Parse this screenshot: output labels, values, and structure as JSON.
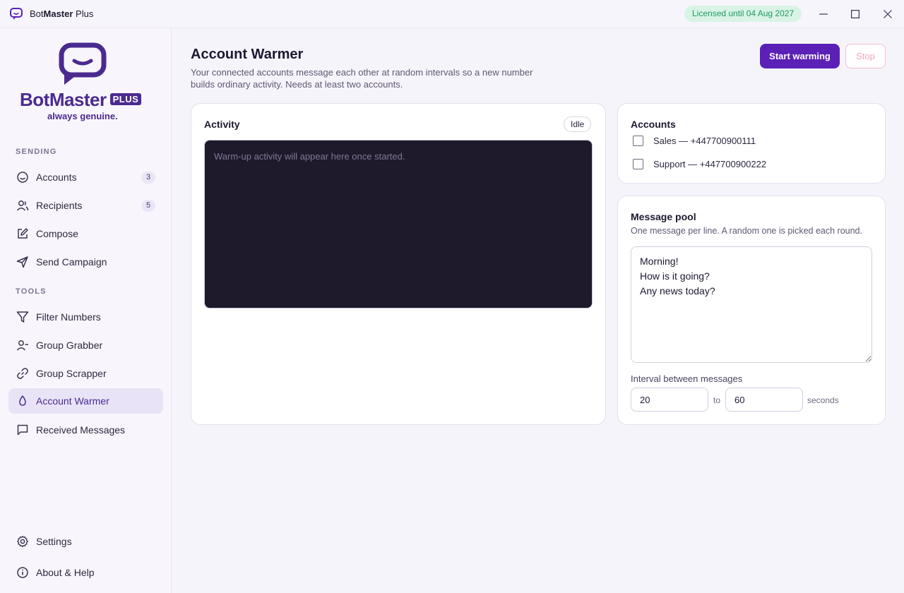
{
  "app": {
    "name_prefix": "Bot",
    "name_bold": "Master",
    "name_suffix": " Plus",
    "license": "Licensed until 04 Aug 2027"
  },
  "brand": {
    "name": "BotMaster",
    "plus": "PLUS",
    "tagline": "always genuine."
  },
  "colors": {
    "accent": "#5b21b6",
    "brand": "#4a2a8f",
    "license_bg": "#d9f4e6",
    "license_text": "#1f9a5e",
    "stop": "#f0a7bd"
  },
  "sidebar": {
    "sections": {
      "sending": "SENDING",
      "tools": "TOOLS"
    },
    "sending_items": [
      {
        "label": "Accounts",
        "icon": "smile-icon",
        "badge": "3"
      },
      {
        "label": "Recipients",
        "icon": "users-icon",
        "badge": "5"
      },
      {
        "label": "Compose",
        "icon": "edit-icon"
      },
      {
        "label": "Send Campaign",
        "icon": "send-icon"
      }
    ],
    "tools_items": [
      {
        "label": "Filter Numbers",
        "icon": "filter-icon"
      },
      {
        "label": "Group Grabber",
        "icon": "user-minus-icon"
      },
      {
        "label": "Group Scrapper",
        "icon": "link-icon"
      },
      {
        "label": "Account Warmer",
        "icon": "flame-icon",
        "active": true
      },
      {
        "label": "Received Messages",
        "icon": "message-icon"
      }
    ],
    "footer_items": [
      {
        "label": "Settings",
        "icon": "gear-icon"
      },
      {
        "label": "About & Help",
        "icon": "info-icon"
      }
    ]
  },
  "page": {
    "title": "Account Warmer",
    "description": "Your connected accounts message each other at random intervals so a new number builds ordinary activity. Needs at least two accounts.",
    "start_label": "Start warming",
    "stop_label": "Stop"
  },
  "activity": {
    "title": "Activity",
    "status": "Idle",
    "empty": "Warm-up activity will appear here once started."
  },
  "accounts": {
    "title": "Accounts",
    "items": [
      {
        "label": "Sales — +447700900111",
        "checked": false
      },
      {
        "label": "Support — +447700900222",
        "checked": false
      }
    ]
  },
  "pool": {
    "title": "Message pool",
    "hint": "One message per line. A random one is picked each round.",
    "messages": "Morning!\nHow is it going?\nAny news today?",
    "interval_label": "Interval between messages",
    "min": "20",
    "to": "to",
    "max": "60",
    "unit": "seconds"
  }
}
